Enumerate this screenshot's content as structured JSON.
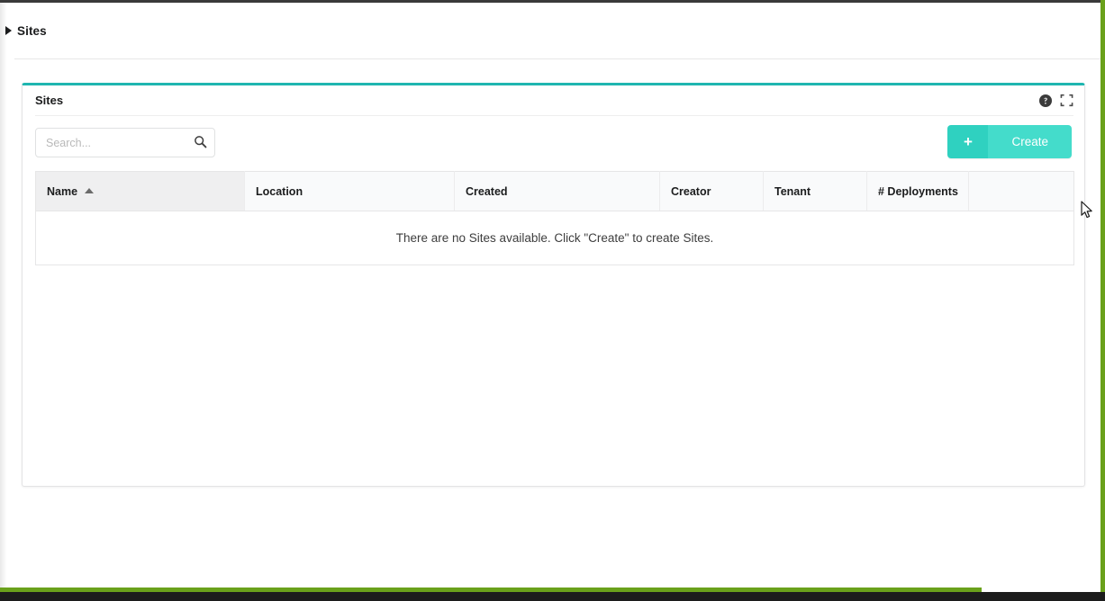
{
  "breadcrumb": {
    "arrow_icon": "caret-right-icon",
    "label": "Sites"
  },
  "panel": {
    "title": "Sites",
    "accent_color": "#1fb6b0",
    "help_icon": "help-circle-icon",
    "expand_icon": "expand-fullscreen-icon"
  },
  "toolbar": {
    "search_placeholder": "Search...",
    "search_value": "",
    "search_icon": "search-icon",
    "create_label": "Create",
    "create_icon": "plus-icon",
    "create_color": "#44dccb"
  },
  "table": {
    "columns": [
      {
        "label": "Name",
        "sorted": true,
        "sort_direction": "ascending"
      },
      {
        "label": "Location",
        "sorted": false,
        "sort_direction": ""
      },
      {
        "label": "Created",
        "sorted": false,
        "sort_direction": ""
      },
      {
        "label": "Creator",
        "sorted": false,
        "sort_direction": ""
      },
      {
        "label": "Tenant",
        "sorted": false,
        "sort_direction": ""
      },
      {
        "label": "# Deployments",
        "sorted": false,
        "sort_direction": ""
      },
      {
        "label": "",
        "sorted": false,
        "sort_direction": ""
      }
    ],
    "rows": [],
    "empty_message": "There are no Sites available. Click \"Create\" to create Sites."
  },
  "cursor": {
    "icon": "mouse-pointer-icon"
  }
}
